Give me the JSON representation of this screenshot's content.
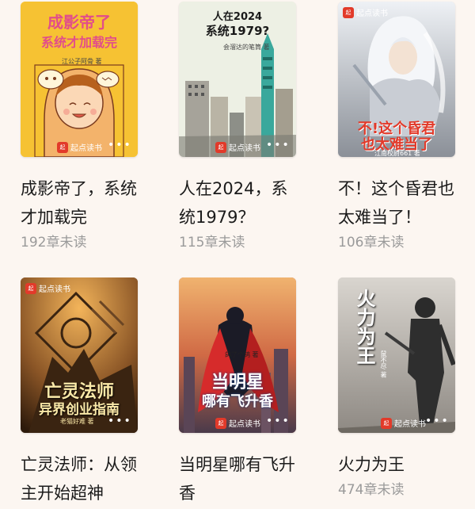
{
  "books": [
    {
      "title": "成影帝了，系统才加载完",
      "meta": "192章未读",
      "cover": {
        "line1": "成影帝了",
        "line2": "系统才加载完",
        "author": "江公子阿骨 著",
        "publisher": "起点读书",
        "bg": "#f7c83a",
        "accent": "#e24d8a"
      }
    },
    {
      "title": "人在2024，系统1979？",
      "meta": "115章未读",
      "cover": {
        "line1": "人在2024",
        "line2": "系统1979?",
        "author": "会溜达的笔筒 著",
        "publisher": "起点读书",
        "bg": "#e9eedf",
        "accent": "#1a1a1a"
      }
    },
    {
      "title": "不！这个昏君也太难当了！",
      "meta": "106章未读",
      "cover": {
        "line1": "不!这个昏君",
        "line2": "也太难当了",
        "author": "江南校尉661 著",
        "publisher": "起点读书",
        "bg": "#d9dde4",
        "accent": "#e23a2a"
      }
    },
    {
      "title": "亡灵法师：从领主开始超神",
      "meta": "",
      "cover": {
        "line1": "亡灵法师",
        "line2": "异界创业指南",
        "author": "老猫好难 著",
        "publisher": "起点读书",
        "bg": "#5a3a1e",
        "accent": "#fbe9a8"
      }
    },
    {
      "title": "当明星哪有飞升香",
      "meta": "",
      "cover": {
        "line1": "当明星",
        "line2": "哪有飞升香",
        "author": "鸽了个鸽 著",
        "publisher": "起点读书",
        "bg": "#c95b3c",
        "accent": "#ffffff"
      }
    },
    {
      "title": "火力为王",
      "meta": "474章未读",
      "cover": {
        "line1": "火力为王",
        "line2": "",
        "author": "鼠不尽 著",
        "publisher": "起点读书",
        "bg": "#c9c4bd",
        "accent": "#ffffff"
      }
    }
  ]
}
